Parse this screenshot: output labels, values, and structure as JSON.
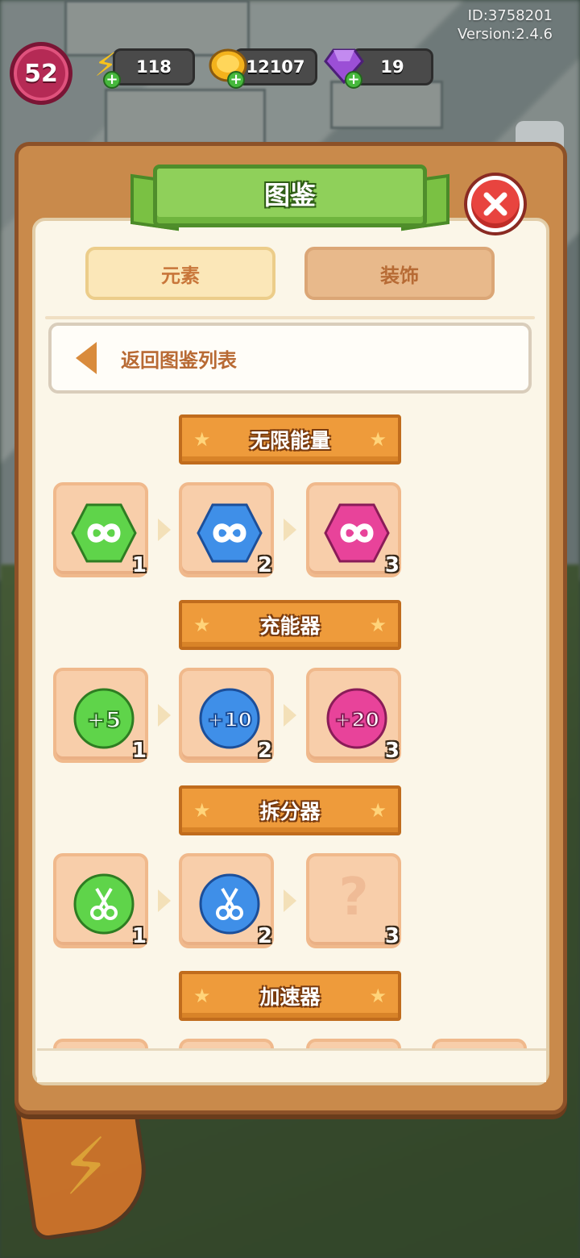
{
  "hud": {
    "id_text": "ID:3758201",
    "version_text": "Version:2.4.6",
    "level": "52",
    "energy": "118",
    "coins": "12107",
    "gems": "19"
  },
  "dialog": {
    "title": "图鉴",
    "tabs": [
      {
        "label": "元素",
        "active": true
      },
      {
        "label": "装饰",
        "active": false
      }
    ],
    "back_label": "返回图鉴列表"
  },
  "sections": [
    {
      "title": "无限能量",
      "items": [
        {
          "level": "1",
          "color": "green",
          "icon": "infinity-icon"
        },
        {
          "level": "2",
          "color": "blue",
          "icon": "infinity-icon"
        },
        {
          "level": "3",
          "color": "pink",
          "icon": "infinity-icon"
        }
      ]
    },
    {
      "title": "充能器",
      "items": [
        {
          "level": "1",
          "color": "green",
          "icon": "charge-plus-5-icon",
          "value": "+5"
        },
        {
          "level": "2",
          "color": "blue",
          "icon": "charge-plus-10-icon",
          "value": "+10"
        },
        {
          "level": "3",
          "color": "pink",
          "icon": "charge-plus-20-icon",
          "value": "+20"
        }
      ]
    },
    {
      "title": "拆分器",
      "items": [
        {
          "level": "1",
          "color": "green",
          "icon": "scissors-icon"
        },
        {
          "level": "2",
          "color": "blue",
          "icon": "scissors-icon"
        },
        {
          "level": "3",
          "color": "locked",
          "icon": "question-mark-icon",
          "value": "?"
        }
      ]
    },
    {
      "title": "加速器",
      "items": []
    }
  ],
  "colors": {
    "green": "#5fd44a",
    "blue": "#3f8fe8",
    "pink": "#e8439a",
    "panel": "#c98a4b",
    "ribbon": "#ee9b3b"
  }
}
